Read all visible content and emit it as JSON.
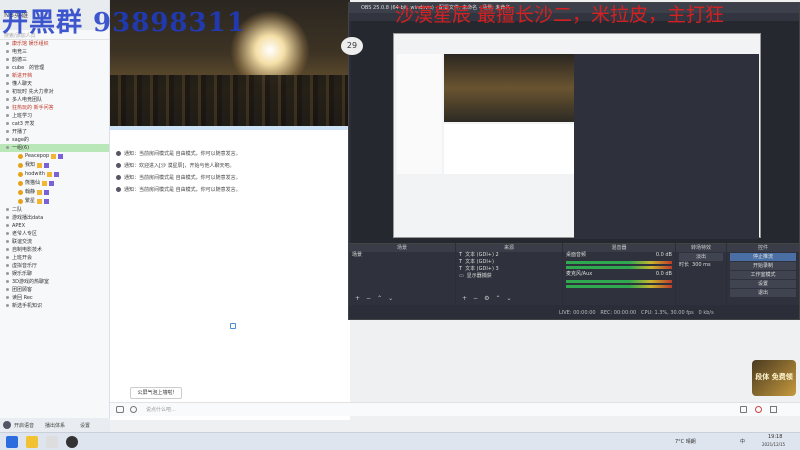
{
  "watermark": {
    "left_text": "开黑群 93898311",
    "right_text": "沙漠星辰 最擅长沙二，米拉皮，主打狂"
  },
  "left_panel": {
    "title": "NB英雄",
    "search_placeholder": "搜索/添加人员",
    "channels": [
      {
        "label": "康乐馆 娱乐组织",
        "red": true
      },
      {
        "label": "电竞三",
        "red": false
      },
      {
        "label": "韵德三",
        "red": false
      },
      {
        "label": "cube　的管理",
        "red": false
      },
      {
        "label": "新进开档",
        "red": true
      },
      {
        "label": "懂人聊天",
        "red": false
      },
      {
        "label": "初玩时 先大力拿对",
        "red": false
      },
      {
        "label": "多人电竞团队",
        "red": false
      },
      {
        "label": "狂热玩的 新手问答",
        "red": true
      },
      {
        "label": "上班学习",
        "red": false
      },
      {
        "label": "cat3 开发",
        "red": false
      },
      {
        "label": "开播了",
        "red": false
      },
      {
        "label": "sage的",
        "red": false
      }
    ],
    "active_channel": "一组(6)",
    "users": [
      {
        "name": "Peacepop"
      },
      {
        "name": "我知"
      },
      {
        "name": "hodwith"
      },
      {
        "name": "熊猫仙"
      },
      {
        "name": "翰静"
      },
      {
        "name": "繁星"
      }
    ],
    "more_channels": [
      "二队",
      "游戏播出data",
      "APEX",
      "老爷人专区",
      "联谊交流",
      "自制电影技术",
      "上班开会",
      "虚拟音乐厅",
      "娱乐乐聊",
      "3D游戏的热聊室",
      "团团顾客",
      "读回 Rec",
      "新选手机知识"
    ],
    "bottom_tools": [
      "开启语音",
      "播出体系",
      "设置"
    ]
  },
  "chat": {
    "messages": [
      "通知：当前房间模式是 自由模式，你可以随意发言。",
      "通知：欢迎进入[沙 漠星辰]，开始与他人聊天吧。",
      "通知：当前房间模式是 自由模式，你可以随意发言。",
      "通知：当前房间模式是 自由模式，你可以随意发言。"
    ],
    "pinned_label": "公屏气泡上墙啦!",
    "input_placeholder": "说点什么吧..."
  },
  "obs": {
    "title": "OBS 25.0.8 (64-bit, windows) - 配置文件: 未命名 - 场景: 未命名",
    "preview_side_number": "29",
    "panels": {
      "scenes": {
        "title": "场景",
        "items": [
          "场景"
        ]
      },
      "sources": {
        "title": "来源",
        "items": [
          "文本 (GDI+) 2",
          "文本 (GDI+)",
          "文本 (GDI+) 3",
          "显示器捕获"
        ]
      },
      "mixer": {
        "title": "混音器",
        "tracks": [
          {
            "name": "桌面音频",
            "db": "0.0 dB"
          },
          {
            "name": "麦克风/Aux",
            "db": "0.0 dB"
          }
        ]
      },
      "transitions": {
        "title": "转场特效",
        "type": "淡出",
        "duration_label": "时长",
        "duration": "300 ms"
      },
      "controls": {
        "title": "控件",
        "buttons": [
          "停止推流",
          "开始录制",
          "工作室模式",
          "设置",
          "退出"
        ]
      }
    },
    "status_bar": {
      "live": "LIVE: 00:00:00",
      "rec": "REC: 00:00:00",
      "cpu": "CPU: 1.3%, 30.00 fps",
      "kbps": "0 kb/s"
    }
  },
  "promo": {
    "text": "段体 免费领"
  },
  "taskbar": {
    "weather": "7°C 晴朗",
    "time": "19:18",
    "date": "2021/12/15",
    "items": [
      "英雄联盟",
      "微信"
    ],
    "lang": "中"
  },
  "colors": {
    "accent": "#4a6fa5",
    "meter_green": "#2fa84f",
    "watermark_blue": "#1e3cc8",
    "watermark_red": "#e61e1e"
  }
}
